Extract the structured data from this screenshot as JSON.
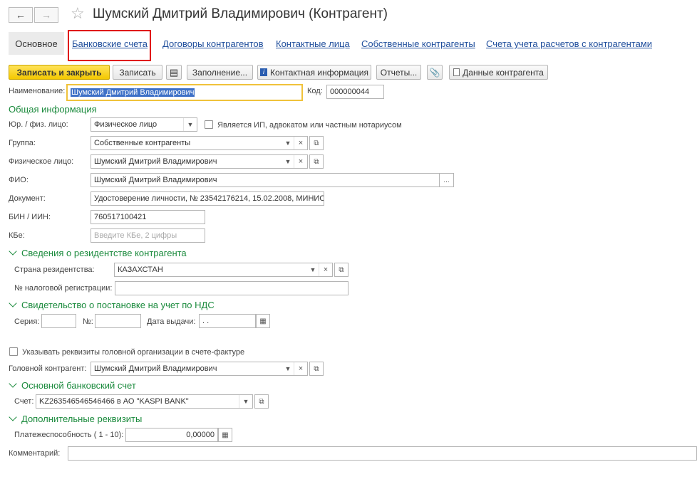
{
  "window": {
    "title": "Шумский Дмитрий Владимирович (Контрагент)"
  },
  "nav": {
    "back_icon": "arrow-left-icon",
    "forward_icon": "arrow-right-icon",
    "favorite_icon": "star-icon"
  },
  "tabs": {
    "main": "Основное",
    "links": [
      "Банковские счета",
      "Договоры контрагентов",
      "Контактные лица",
      "Собственные контрагенты",
      "Счета учета расчетов с контрагентами"
    ]
  },
  "toolbar": {
    "save_close": "Записать и закрыть",
    "save": "Записать",
    "fill": "Заполнение...",
    "contact_info": "Контактная информация",
    "reports": "Отчеты...",
    "counterparty_data": "Данные контрагента"
  },
  "form": {
    "name_label": "Наименование:",
    "name_value": "Шумский Дмитрий Владимирович",
    "code_label": "Код:",
    "code_value": "000000044",
    "general_section": "Общая информация",
    "legal_type_label": "Юр. / физ. лицо:",
    "legal_type_value": "Физическое лицо",
    "ip_checkbox_label": "Является ИП, адвокатом или частным нотариусом",
    "group_label": "Группа:",
    "group_value": "Собственные контрагенты",
    "person_label": "Физическое лицо:",
    "person_value": "Шумский Дмитрий Владимирович",
    "fio_label": "ФИО:",
    "fio_value": "Шумский Дмитрий Владимирович",
    "document_label": "Документ:",
    "document_value": "Удостоверение личности, № 23542176214, 15.02.2008, МИНИС",
    "bin_label": "БИН / ИИН:",
    "bin_value": "760517100421",
    "kbe_label": "КБе:",
    "kbe_placeholder": "Введите КБе, 2 цифры",
    "residency_section": "Сведения о резидентстве контрагента",
    "country_label": "Страна резидентства:",
    "country_value": "КАЗАХСТАН",
    "tax_reg_label": "№ налоговой регистрации:",
    "vat_section": "Свидетельство о постановке на учет по НДС",
    "series_label": "Серия:",
    "number_label": "№:",
    "issue_date_label": "Дата выдачи:",
    "issue_date_value": " .  .",
    "head_org_checkbox_label": "Указывать реквизиты головной организации в счете-фактуре",
    "head_counterparty_label": "Головной контрагент:",
    "head_counterparty_value": "Шумский Дмитрий Владимирович",
    "bank_section": "Основной банковский счет",
    "account_label": "Счет:",
    "account_value": "KZ263546546546466 в АО \"KASPI BANK\"",
    "extra_section": "Дополнительные реквизиты",
    "solvency_label": "Платежеспособность ( 1 - 10):",
    "solvency_value": "0,00000",
    "comment_label": "Комментарий:"
  }
}
